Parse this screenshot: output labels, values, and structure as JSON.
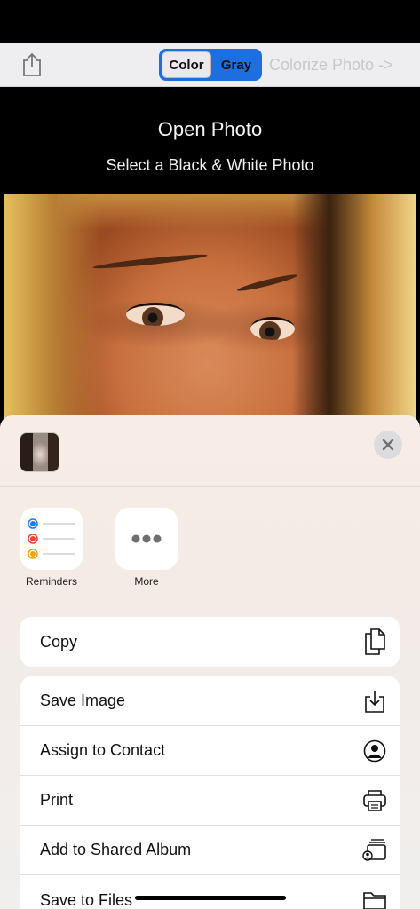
{
  "toolbar": {
    "segments": [
      {
        "label": "Color",
        "selected": true
      },
      {
        "label": "Gray",
        "selected": false
      }
    ],
    "colorize_label": "Colorize Photo ->",
    "accent_color": "#1d6fe0"
  },
  "header": {
    "title": "Open Photo",
    "subtitle": "Select a Black & White Photo"
  },
  "share_sheet": {
    "apps": [
      {
        "label": "Reminders",
        "icon": "reminders-icon"
      },
      {
        "label": "More",
        "icon": "more-icon"
      }
    ],
    "actions_primary": [
      {
        "label": "Copy",
        "icon": "copy-icon"
      }
    ],
    "actions": [
      {
        "label": "Save Image",
        "icon": "save-image-icon"
      },
      {
        "label": "Assign to Contact",
        "icon": "contact-icon"
      },
      {
        "label": "Print",
        "icon": "printer-icon"
      },
      {
        "label": "Add to Shared Album",
        "icon": "shared-album-icon"
      },
      {
        "label": "Save to Files",
        "icon": "folder-icon"
      }
    ]
  }
}
